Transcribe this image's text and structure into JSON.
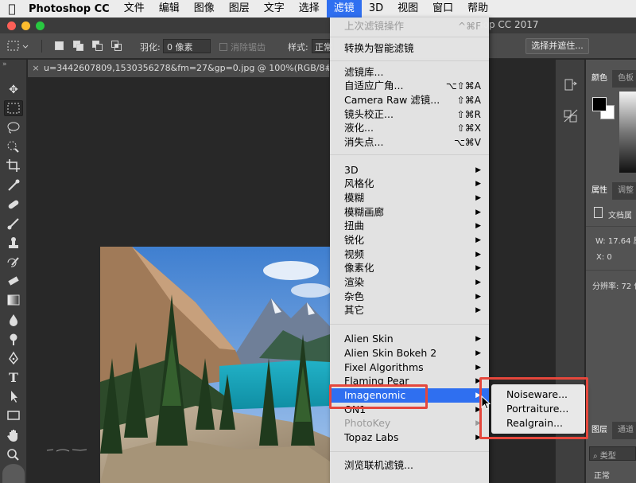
{
  "menubar": {
    "app_name": "Photoshop CC",
    "items": [
      "文件",
      "编辑",
      "图像",
      "图层",
      "文字",
      "选择",
      "滤镜",
      "3D",
      "视图",
      "窗口",
      "帮助"
    ],
    "active_item": "滤镜"
  },
  "window": {
    "title": "hop CC 2017"
  },
  "options_bar": {
    "feather_label": "羽化:",
    "feather_value": "0 像素",
    "antialias_label": "消除锯齿",
    "style_label": "样式:",
    "style_value": "正常",
    "mask_button": "选择并遮住..."
  },
  "document_tab": {
    "label": "u=3442607809,1530356278&fm=27&gp=0.jpg @ 100%(RGB/8#"
  },
  "filter_menu": {
    "items": [
      {
        "label": "上次滤镜操作",
        "shortcut": "^⌘F",
        "disabled": true
      },
      {
        "label": "转换为智能滤镜"
      },
      {
        "label": "滤镜库..."
      },
      {
        "label": "自适应广角...",
        "shortcut": "⌥⇧⌘A"
      },
      {
        "label": "Camera Raw 滤镜...",
        "shortcut": "⇧⌘A"
      },
      {
        "label": "镜头校正...",
        "shortcut": "⇧⌘R"
      },
      {
        "label": "液化...",
        "shortcut": "⇧⌘X"
      },
      {
        "label": "消失点...",
        "shortcut": "⌥⌘V"
      },
      {
        "label": "3D",
        "submenu": true
      },
      {
        "label": "风格化",
        "submenu": true
      },
      {
        "label": "模糊",
        "submenu": true
      },
      {
        "label": "模糊画廊",
        "submenu": true
      },
      {
        "label": "扭曲",
        "submenu": true
      },
      {
        "label": "锐化",
        "submenu": true
      },
      {
        "label": "视频",
        "submenu": true
      },
      {
        "label": "像素化",
        "submenu": true
      },
      {
        "label": "渲染",
        "submenu": true
      },
      {
        "label": "杂色",
        "submenu": true
      },
      {
        "label": "其它",
        "submenu": true
      },
      {
        "label": "Alien Skin",
        "submenu": true
      },
      {
        "label": "Alien Skin Bokeh 2",
        "submenu": true
      },
      {
        "label": "Fixel Algorithms",
        "submenu": true
      },
      {
        "label": "Flaming Pear",
        "submenu": true
      },
      {
        "label": "Imagenomic",
        "submenu": true,
        "highlighted": true
      },
      {
        "label": "ON1",
        "submenu": true
      },
      {
        "label": "PhotoKey",
        "submenu": true,
        "disabled": true
      },
      {
        "label": "Topaz Labs",
        "submenu": true
      },
      {
        "label": "浏览联机滤镜..."
      }
    ]
  },
  "imagenomic_submenu": {
    "items": [
      "Noiseware...",
      "Portraiture...",
      "Realgrain..."
    ]
  },
  "right_panel": {
    "color_tabs": [
      "颜色",
      "色板"
    ],
    "properties_tabs": [
      "属性",
      "调整"
    ],
    "doc_label": "文档属",
    "w_text": "W: 17.64 厘",
    "x_text": "X: 0",
    "resolution_text": "分辨率: 72 像",
    "layers_tabs": [
      "图层",
      "通道"
    ],
    "layer_filter_placeholder": "类型",
    "blend_mode": "正常"
  },
  "colors": {
    "highlight": "#2f6ff0",
    "annotation_red": "#e5473c"
  }
}
